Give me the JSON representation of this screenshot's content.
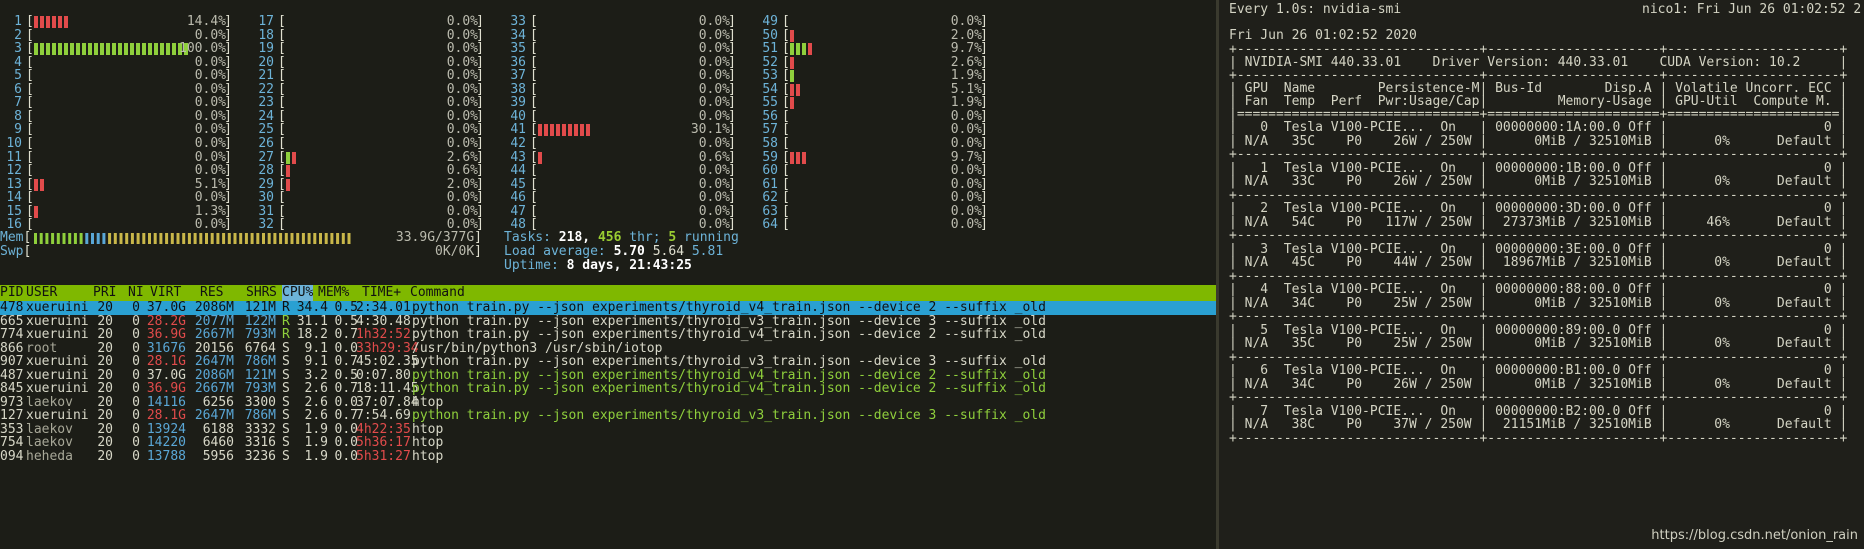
{
  "htop": {
    "cpus": [
      {
        "id": "1",
        "pct": "14.4%",
        "bars": [
          {
            "c": "red",
            "n": 6
          }
        ]
      },
      {
        "id": "2",
        "pct": "0.0%",
        "bars": []
      },
      {
        "id": "3",
        "pct": "100.0%",
        "bars": [
          {
            "c": "green",
            "n": 26
          }
        ]
      },
      {
        "id": "4",
        "pct": "0.0%",
        "bars": []
      },
      {
        "id": "5",
        "pct": "0.0%",
        "bars": []
      },
      {
        "id": "6",
        "pct": "0.0%",
        "bars": []
      },
      {
        "id": "7",
        "pct": "0.0%",
        "bars": []
      },
      {
        "id": "8",
        "pct": "0.0%",
        "bars": []
      },
      {
        "id": "9",
        "pct": "0.0%",
        "bars": []
      },
      {
        "id": "10",
        "pct": "0.0%",
        "bars": []
      },
      {
        "id": "11",
        "pct": "0.0%",
        "bars": []
      },
      {
        "id": "12",
        "pct": "0.0%",
        "bars": []
      },
      {
        "id": "13",
        "pct": "5.1%",
        "bars": [
          {
            "c": "red",
            "n": 2
          }
        ]
      },
      {
        "id": "14",
        "pct": "0.0%",
        "bars": []
      },
      {
        "id": "15",
        "pct": "1.3%",
        "bars": [
          {
            "c": "red",
            "n": 1
          }
        ]
      },
      {
        "id": "16",
        "pct": "0.0%",
        "bars": []
      },
      {
        "id": "17",
        "pct": "0.0%",
        "bars": []
      },
      {
        "id": "18",
        "pct": "0.0%",
        "bars": []
      },
      {
        "id": "19",
        "pct": "0.0%",
        "bars": []
      },
      {
        "id": "20",
        "pct": "0.0%",
        "bars": []
      },
      {
        "id": "21",
        "pct": "0.0%",
        "bars": []
      },
      {
        "id": "22",
        "pct": "0.0%",
        "bars": []
      },
      {
        "id": "23",
        "pct": "0.0%",
        "bars": []
      },
      {
        "id": "24",
        "pct": "0.0%",
        "bars": []
      },
      {
        "id": "25",
        "pct": "0.0%",
        "bars": []
      },
      {
        "id": "26",
        "pct": "0.0%",
        "bars": []
      },
      {
        "id": "27",
        "pct": "2.6%",
        "bars": [
          {
            "c": "green",
            "n": 1
          },
          {
            "c": "red",
            "n": 1
          }
        ]
      },
      {
        "id": "28",
        "pct": "0.6%",
        "bars": [
          {
            "c": "red",
            "n": 1
          }
        ]
      },
      {
        "id": "29",
        "pct": "2.0%",
        "bars": [
          {
            "c": "red",
            "n": 1
          }
        ]
      },
      {
        "id": "30",
        "pct": "0.0%",
        "bars": []
      },
      {
        "id": "31",
        "pct": "0.0%",
        "bars": []
      },
      {
        "id": "32",
        "pct": "0.0%",
        "bars": []
      },
      {
        "id": "33",
        "pct": "0.0%",
        "bars": []
      },
      {
        "id": "34",
        "pct": "0.0%",
        "bars": []
      },
      {
        "id": "35",
        "pct": "0.0%",
        "bars": []
      },
      {
        "id": "36",
        "pct": "0.0%",
        "bars": []
      },
      {
        "id": "37",
        "pct": "0.0%",
        "bars": []
      },
      {
        "id": "38",
        "pct": "0.0%",
        "bars": []
      },
      {
        "id": "39",
        "pct": "0.0%",
        "bars": []
      },
      {
        "id": "40",
        "pct": "0.0%",
        "bars": []
      },
      {
        "id": "41",
        "pct": "30.1%",
        "bars": [
          {
            "c": "red",
            "n": 9
          }
        ]
      },
      {
        "id": "42",
        "pct": "0.0%",
        "bars": []
      },
      {
        "id": "43",
        "pct": "0.6%",
        "bars": [
          {
            "c": "red",
            "n": 1
          }
        ]
      },
      {
        "id": "44",
        "pct": "0.0%",
        "bars": []
      },
      {
        "id": "45",
        "pct": "0.0%",
        "bars": []
      },
      {
        "id": "46",
        "pct": "0.0%",
        "bars": []
      },
      {
        "id": "47",
        "pct": "0.0%",
        "bars": []
      },
      {
        "id": "48",
        "pct": "0.0%",
        "bars": []
      },
      {
        "id": "49",
        "pct": "0.0%",
        "bars": []
      },
      {
        "id": "50",
        "pct": "2.0%",
        "bars": [
          {
            "c": "red",
            "n": 1
          }
        ]
      },
      {
        "id": "51",
        "pct": "9.7%",
        "bars": [
          {
            "c": "green",
            "n": 3
          },
          {
            "c": "red",
            "n": 1
          }
        ]
      },
      {
        "id": "52",
        "pct": "2.6%",
        "bars": [
          {
            "c": "red",
            "n": 1
          }
        ]
      },
      {
        "id": "53",
        "pct": "1.9%",
        "bars": [
          {
            "c": "green",
            "n": 1
          }
        ]
      },
      {
        "id": "54",
        "pct": "5.1%",
        "bars": [
          {
            "c": "red",
            "n": 2
          }
        ]
      },
      {
        "id": "55",
        "pct": "1.9%",
        "bars": [
          {
            "c": "red",
            "n": 1
          }
        ]
      },
      {
        "id": "56",
        "pct": "0.0%",
        "bars": []
      },
      {
        "id": "57",
        "pct": "0.0%",
        "bars": []
      },
      {
        "id": "58",
        "pct": "0.0%",
        "bars": []
      },
      {
        "id": "59",
        "pct": "9.7%",
        "bars": [
          {
            "c": "red",
            "n": 3
          }
        ]
      },
      {
        "id": "60",
        "pct": "0.0%",
        "bars": []
      },
      {
        "id": "61",
        "pct": "0.0%",
        "bars": []
      },
      {
        "id": "62",
        "pct": "0.0%",
        "bars": []
      },
      {
        "id": "63",
        "pct": "0.0%",
        "bars": []
      },
      {
        "id": "64",
        "pct": "0.0%",
        "bars": []
      }
    ],
    "mem": {
      "label": "Mem",
      "value": "33.9G/377G",
      "fill": 0.09
    },
    "swp": {
      "label": "Swp",
      "value": "0K/0K",
      "fill": 0
    },
    "tasks": {
      "label": "Tasks:",
      "count": "218,",
      "thr": "456",
      "thr_label": "thr;",
      "running": "5",
      "running_label": "running"
    },
    "load": {
      "label": "Load average:",
      "l1": "5.70",
      "l5": "5.64",
      "l15": "5.81"
    },
    "uptime": {
      "label": "Uptime:",
      "value": "8 days, 21:43:25"
    },
    "columns": [
      "PID",
      "USER",
      "PRI",
      "NI",
      "VIRT",
      "RES",
      "SHR",
      "S",
      "CPU%",
      "MEM%",
      "TIME+",
      "Command"
    ],
    "processes": [
      {
        "pid": "478",
        "user": "xueruini",
        "pri": "20",
        "ni": "0",
        "virt": "37.0G",
        "res": "2086M",
        "shr": "121M",
        "s": "R",
        "cpu": "34.4",
        "mem": "0.5",
        "time": "2:34.01",
        "cmd": "python train.py --json experiments/thyroid_v4_train.json --device 2 --suffix _old",
        "selected": true,
        "cmdcolor": "plain"
      },
      {
        "pid": "665",
        "user": "xueruini",
        "pri": "20",
        "ni": "0",
        "virt": "28.2G",
        "res": "2077M",
        "shr": "122M",
        "s": "R",
        "cpu": "31.1",
        "mem": "0.5",
        "time": "4:30.48",
        "cmd": "python train.py --json experiments/thyroid_v3_train.json --device 3 --suffix _old",
        "cmdcolor": "plain"
      },
      {
        "pid": "774",
        "user": "xueruini",
        "pri": "20",
        "ni": "0",
        "virt": "36.9G",
        "res": "2667M",
        "shr": "793M",
        "s": "R",
        "cpu": "18.2",
        "mem": "0.7",
        "time": "1h32:52",
        "cmd": "python train.py --json experiments/thyroid_v4_train.json --device 2 --suffix _old",
        "cmdcolor": "plain"
      },
      {
        "pid": "866",
        "user": "root",
        "pri": "20",
        "ni": "0",
        "virt": "31676",
        "res": "20156",
        "shr": "6764",
        "s": "S",
        "cpu": "9.1",
        "mem": "0.0",
        "time": "33h29:34",
        "cmd": "/usr/bin/python3 /usr/sbin/iotop",
        "cmdcolor": "plain"
      },
      {
        "pid": "907",
        "user": "xueruini",
        "pri": "20",
        "ni": "0",
        "virt": "28.1G",
        "res": "2647M",
        "shr": "786M",
        "s": "S",
        "cpu": "9.1",
        "mem": "0.7",
        "time": "45:02.35",
        "cmd": "python train.py --json experiments/thyroid_v3_train.json --device 3 --suffix _old",
        "cmdcolor": "plain"
      },
      {
        "pid": "487",
        "user": "xueruini",
        "pri": "20",
        "ni": "0",
        "virt": "37.0G",
        "res": "2086M",
        "shr": "121M",
        "s": "S",
        "cpu": "3.2",
        "mem": "0.5",
        "time": "0:07.80",
        "cmd": "python train.py --json experiments/thyroid_v4_train.json --device 2 --suffix _old",
        "cmdcolor": "green"
      },
      {
        "pid": "845",
        "user": "xueruini",
        "pri": "20",
        "ni": "0",
        "virt": "36.9G",
        "res": "2667M",
        "shr": "793M",
        "s": "S",
        "cpu": "2.6",
        "mem": "0.7",
        "time": "18:11.45",
        "cmd": "python train.py --json experiments/thyroid_v4_train.json --device 2 --suffix _old",
        "cmdcolor": "green"
      },
      {
        "pid": "973",
        "user": "laekov",
        "pri": "20",
        "ni": "0",
        "virt": "14116",
        "res": "6256",
        "shr": "3300",
        "s": "S",
        "cpu": "2.6",
        "mem": "0.0",
        "time": "37:07.84",
        "cmd": "htop",
        "cmdcolor": "plain"
      },
      {
        "pid": "127",
        "user": "xueruini",
        "pri": "20",
        "ni": "0",
        "virt": "28.1G",
        "res": "2647M",
        "shr": "786M",
        "s": "S",
        "cpu": "2.6",
        "mem": "0.7",
        "time": "7:54.69",
        "cmd": "python train.py --json experiments/thyroid_v3_train.json --device 3 --suffix _old",
        "cmdcolor": "green"
      },
      {
        "pid": "353",
        "user": "laekov",
        "pri": "20",
        "ni": "0",
        "virt": "13924",
        "res": "6188",
        "shr": "3332",
        "s": "S",
        "cpu": "1.9",
        "mem": "0.0",
        "time": "4h22:35",
        "cmd": "htop",
        "cmdcolor": "plain"
      },
      {
        "pid": "754",
        "user": "laekov",
        "pri": "20",
        "ni": "0",
        "virt": "14220",
        "res": "6460",
        "shr": "3316",
        "s": "S",
        "cpu": "1.9",
        "mem": "0.0",
        "time": "5h36:17",
        "cmd": "htop",
        "cmdcolor": "plain"
      },
      {
        "pid": "094",
        "user": "heheda",
        "pri": "20",
        "ni": "0",
        "virt": "13788",
        "res": "5956",
        "shr": "3236",
        "s": "S",
        "cpu": "1.9",
        "mem": "0.0",
        "time": "5h31:27",
        "cmd": "htop",
        "cmdcolor": "plain"
      }
    ]
  },
  "smi": {
    "watch_line": "Every 1.0s: nvidia-smi",
    "host_line": "nico1: Fri Jun 26 01:02:52 2",
    "date_line": "Fri Jun 26 01:02:52 2020",
    "version_line": "| NVIDIA-SMI 440.33.01    Driver Version: 440.33.01    CUDA Version: 10.2     |",
    "header1": "| GPU  Name        Persistence-M| Bus-Id        Disp.A | Volatile Uncorr. ECC |",
    "header2": "| Fan  Temp  Perf  Pwr:Usage/Cap|         Memory-Usage | GPU-Util  Compute M. |",
    "gpus": [
      {
        "l1": "|   0  Tesla V100-PCIE...  On   | 00000000:1A:00.0 Off |                    0 |",
        "l2": "| N/A   35C    P0    26W / 250W |      0MiB / 32510MiB |      0%      Default |"
      },
      {
        "l1": "|   1  Tesla V100-PCIE...  On   | 00000000:1B:00.0 Off |                    0 |",
        "l2": "| N/A   33C    P0    26W / 250W |      0MiB / 32510MiB |      0%      Default |"
      },
      {
        "l1": "|   2  Tesla V100-PCIE...  On   | 00000000:3D:00.0 Off |                    0 |",
        "l2": "| N/A   54C    P0   117W / 250W |  27373MiB / 32510MiB |     46%      Default |"
      },
      {
        "l1": "|   3  Tesla V100-PCIE...  On   | 00000000:3E:00.0 Off |                    0 |",
        "l2": "| N/A   45C    P0    44W / 250W |  18967MiB / 32510MiB |      0%      Default |"
      },
      {
        "l1": "|   4  Tesla V100-PCIE...  On   | 00000000:88:00.0 Off |                    0 |",
        "l2": "| N/A   34C    P0    25W / 250W |      0MiB / 32510MiB |      0%      Default |"
      },
      {
        "l1": "|   5  Tesla V100-PCIE...  On   | 00000000:89:00.0 Off |                    0 |",
        "l2": "| N/A   35C    P0    25W / 250W |      0MiB / 32510MiB |      0%      Default |"
      },
      {
        "l1": "|   6  Tesla V100-PCIE...  On   | 00000000:B1:00.0 Off |                    0 |",
        "l2": "| N/A   34C    P0    26W / 250W |      0MiB / 32510MiB |      0%      Default |"
      },
      {
        "l1": "|   7  Tesla V100-PCIE...  On   | 00000000:B2:00.0 Off |                    0 |",
        "l2": "| N/A   38C    P0    37W / 250W |  21151MiB / 32510MiB |      0%      Default |"
      }
    ],
    "rule_dash": "+-------------------------------+----------------------+----------------------+",
    "rule_eq": "|===============================+======================+======================|"
  },
  "watermark": "https://blog.csdn.net/onion_rain",
  "colors": {
    "red": "#e14b4b",
    "green": "#8fcf3c",
    "blue": "#5aa7d6",
    "header_bg": "#7fb800",
    "selected_bg": "#2aa0d2"
  }
}
